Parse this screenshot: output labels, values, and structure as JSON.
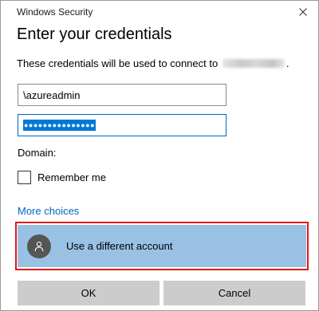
{
  "window": {
    "title": "Windows Security",
    "close_icon": "close-icon"
  },
  "dialog": {
    "heading": "Enter your credentials",
    "description_prefix": "These credentials will be used to connect to",
    "description_suffix": "."
  },
  "fields": {
    "username_value": "\\azureadmin",
    "password_value": "●●●●●●●●●●●●●●●",
    "domain_label": "Domain:"
  },
  "remember": {
    "label": "Remember me",
    "checked": false
  },
  "more_choices": {
    "label": "More choices"
  },
  "account_option": {
    "label": "Use a different account",
    "icon": "user-icon"
  },
  "buttons": {
    "ok": "OK",
    "cancel": "Cancel"
  },
  "colors": {
    "link": "#0067c0",
    "selection": "#0078d7",
    "account_bg": "#99c1e4",
    "highlight_border": "#e01818",
    "button_bg": "#cccccc"
  }
}
